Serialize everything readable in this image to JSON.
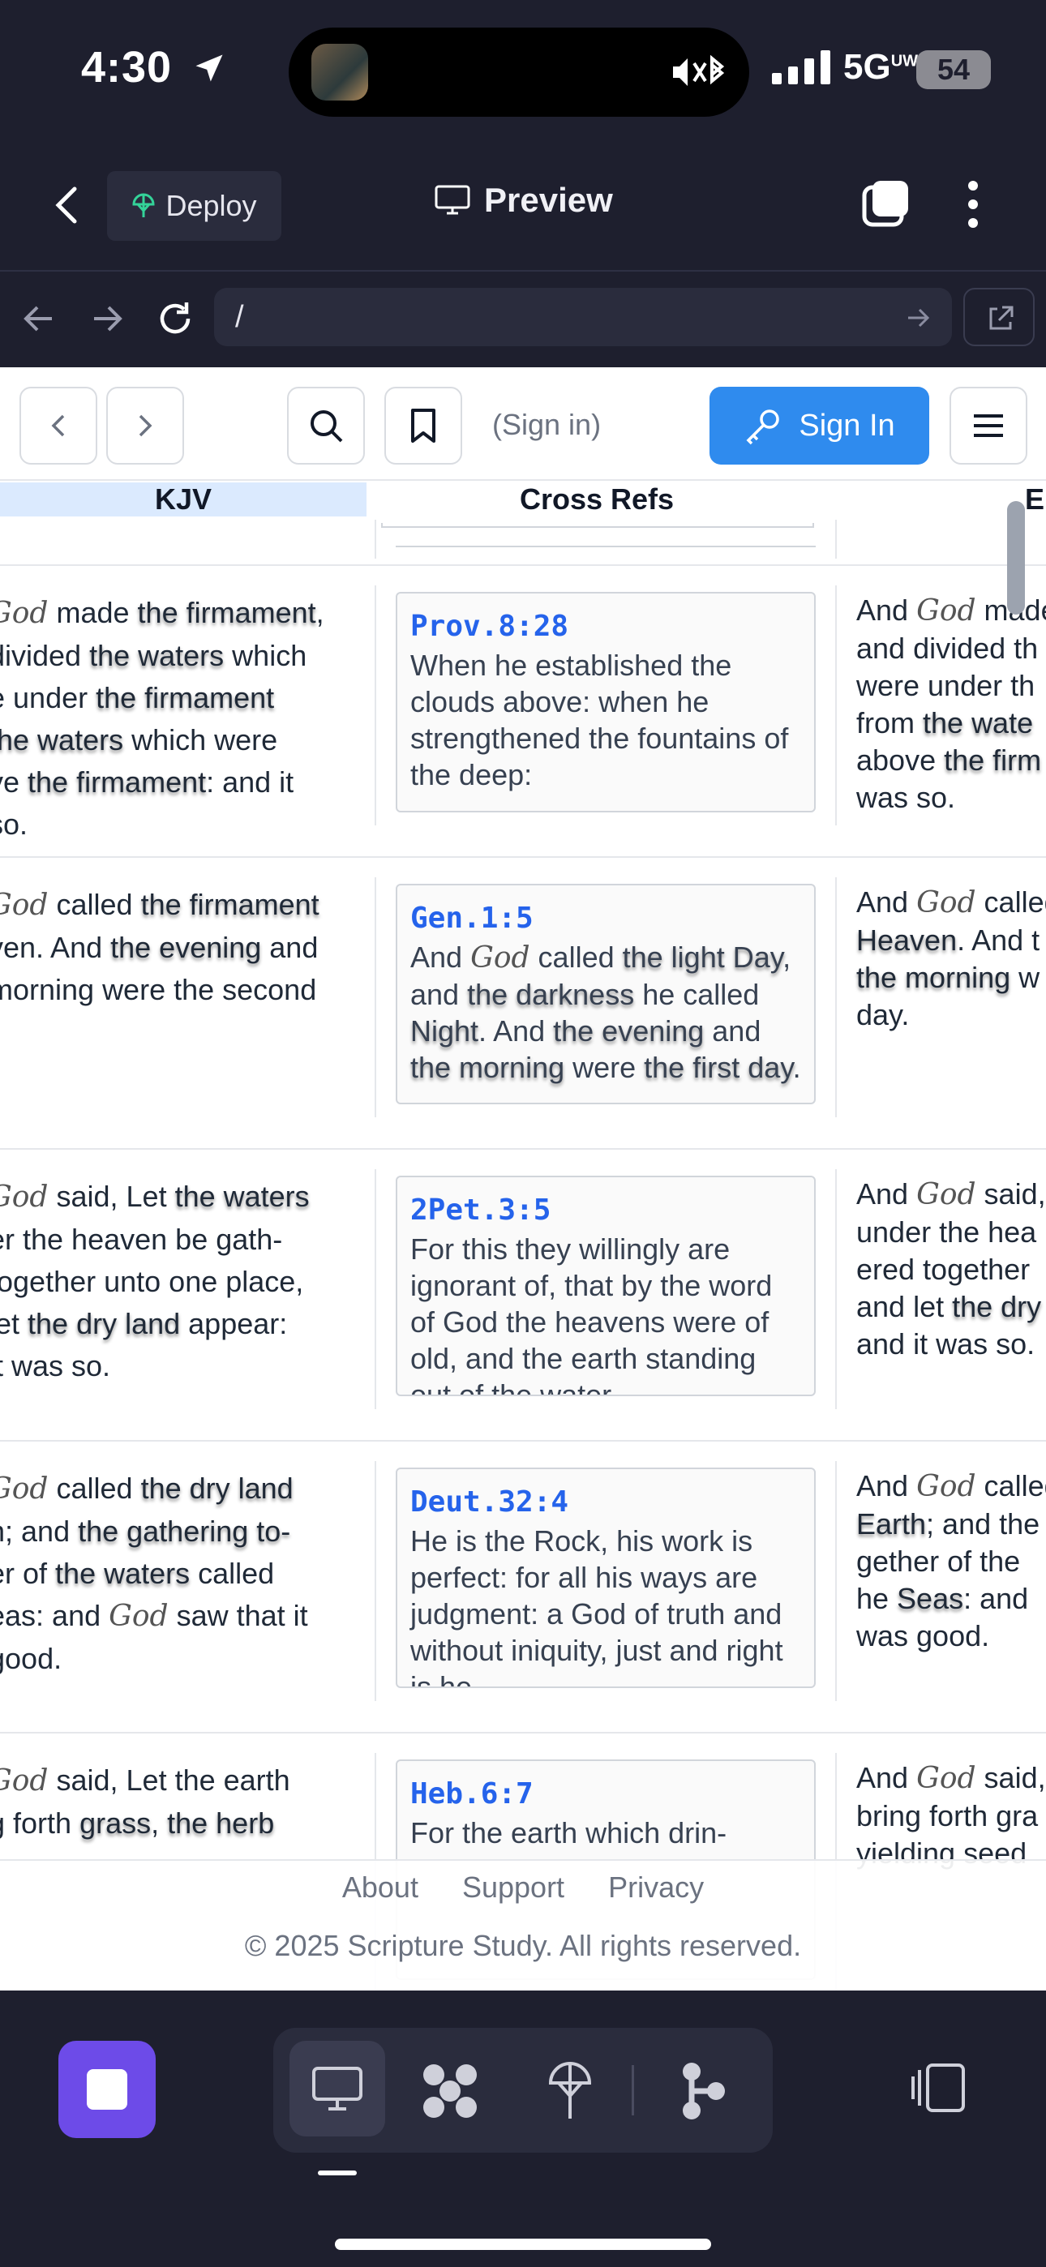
{
  "status_bar": {
    "time": "4:30",
    "network": "5G",
    "network_sub": "UW",
    "battery": "54"
  },
  "app_header": {
    "deploy_label": "Deploy",
    "preview_label": "Preview"
  },
  "url_bar": {
    "path": "/"
  },
  "site_nav": {
    "signin_hint": "(Sign in)",
    "signin_button": "Sign In"
  },
  "columns": {
    "kjv": "KJV",
    "cross_refs": "Cross Refs",
    "esv_partial": "E"
  },
  "rows": [
    {
      "kjv_lines": [
        "made the firmament,",
        "divided the waters which",
        "e under the firmament",
        " the waters which were",
        "ve the firmament: and it",
        "so."
      ],
      "ref": "Prov.8:28",
      "xref_text": "When he established the clouds above: when he strengthened the fountains of the deep:",
      "esv_lines": [
        "And  made",
        "and divided th",
        "were under th",
        "from the wate",
        "above the firm",
        "was so."
      ]
    },
    {
      "kjv_lines": [
        "called the firmament",
        "ven. And the evening and",
        "morning were the second"
      ],
      "ref": "Gen.1:5",
      "xref_text": "And  called the light Day, and the darkness he called Night. And the evening and the morning were the first day.",
      "esv_lines": [
        "And  called",
        "Heaven. And t",
        "the morning w",
        "day."
      ]
    },
    {
      "kjv_lines": [
        "said, Let the waters",
        "er the heaven be gath-",
        " together unto one place,",
        "let the dry land appear:",
        "it was so."
      ],
      "ref": "2Pet.3:5",
      "xref_text": "For this they willingly are ignorant of, that by the word of God the heavens were of old, and the earth standing out of the water",
      "esv_lines": [
        "And  said,",
        "under the hea",
        "ered together",
        "and let the dry",
        "and it was so."
      ]
    },
    {
      "kjv_lines": [
        "called the dry land",
        "h; and the gathering to-",
        "er of the waters called",
        "eas: and  saw that it",
        "good."
      ],
      "ref": "Deut.32:4",
      "xref_text": "He is the Rock, his work is perfect: for all his ways are judgment: a God of truth and without iniquity, just and right is he.",
      "esv_lines": [
        "And  called",
        "Earth; and the",
        "gether of the",
        "he Seas: and",
        "was good."
      ]
    },
    {
      "kjv_lines": [
        "said, Let the earth",
        "g forth grass, the herb"
      ],
      "ref": "Heb.6:7",
      "xref_text": "For the earth which drin-",
      "esv_lines": [
        "And  said,",
        "bring forth gra",
        "yielding seed"
      ]
    }
  ],
  "god_glyph": "God",
  "footer": {
    "about": "About",
    "support": "Support",
    "privacy": "Privacy",
    "copyright": "© 2025 Scripture Study. All rights reserved."
  }
}
